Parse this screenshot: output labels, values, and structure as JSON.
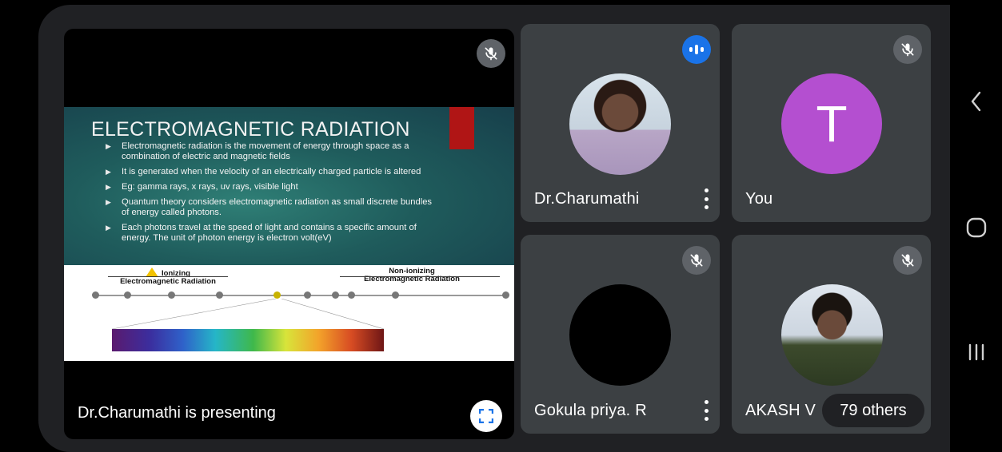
{
  "presenter": {
    "status_label": "Dr.Charumathi is presenting",
    "slide": {
      "title": "ELECTROMAGNETIC RADIATION",
      "bullets": [
        "Electromagnetic radiation is the movement of energy through space as a combination of electric and magnetic fields",
        "It is generated when the velocity of an electrically charged particle is altered",
        "Eg: gamma rays, x rays, uv rays, visible light",
        "Quantum theory considers electromagnetic radiation as small discrete bundles of energy called photons.",
        "Each photons travel at the speed of light and contains a specific amount of energy. The unit of photon energy is electron volt(eV)"
      ],
      "ionizing_label_line1": "Ionizing",
      "ionizing_label_line2": "Electromagnetic Radiation",
      "nonionizing_label_line1": "Non-ionizing",
      "nonionizing_label_line2": "Electromagnetic Radiation"
    },
    "mic_icon": "mic-off-icon",
    "fullscreen_icon": "fullscreen-icon"
  },
  "participants": [
    {
      "name": "Dr.Charumathi",
      "status_icon": "speaking-icon",
      "menu_icon": "more-vert-icon"
    },
    {
      "name": "You",
      "initial": "T",
      "avatar_color": "#b44fd0",
      "status_icon": "mic-off-icon"
    },
    {
      "name": "Gokula priya. R",
      "status_icon": "mic-off-icon",
      "menu_icon": "more-vert-icon"
    },
    {
      "name": "AKASH V",
      "status_icon": "mic-off-icon"
    }
  ],
  "others_label": "79 others",
  "nav": {
    "back_icon": "back-icon",
    "home_icon": "home-icon",
    "recents_icon": "recents-icon"
  },
  "colors": {
    "tile_bg": "#3c4043",
    "frame_bg": "#202124",
    "speaking_blue": "#1a73e8",
    "mic_gray": "#5f6368"
  }
}
